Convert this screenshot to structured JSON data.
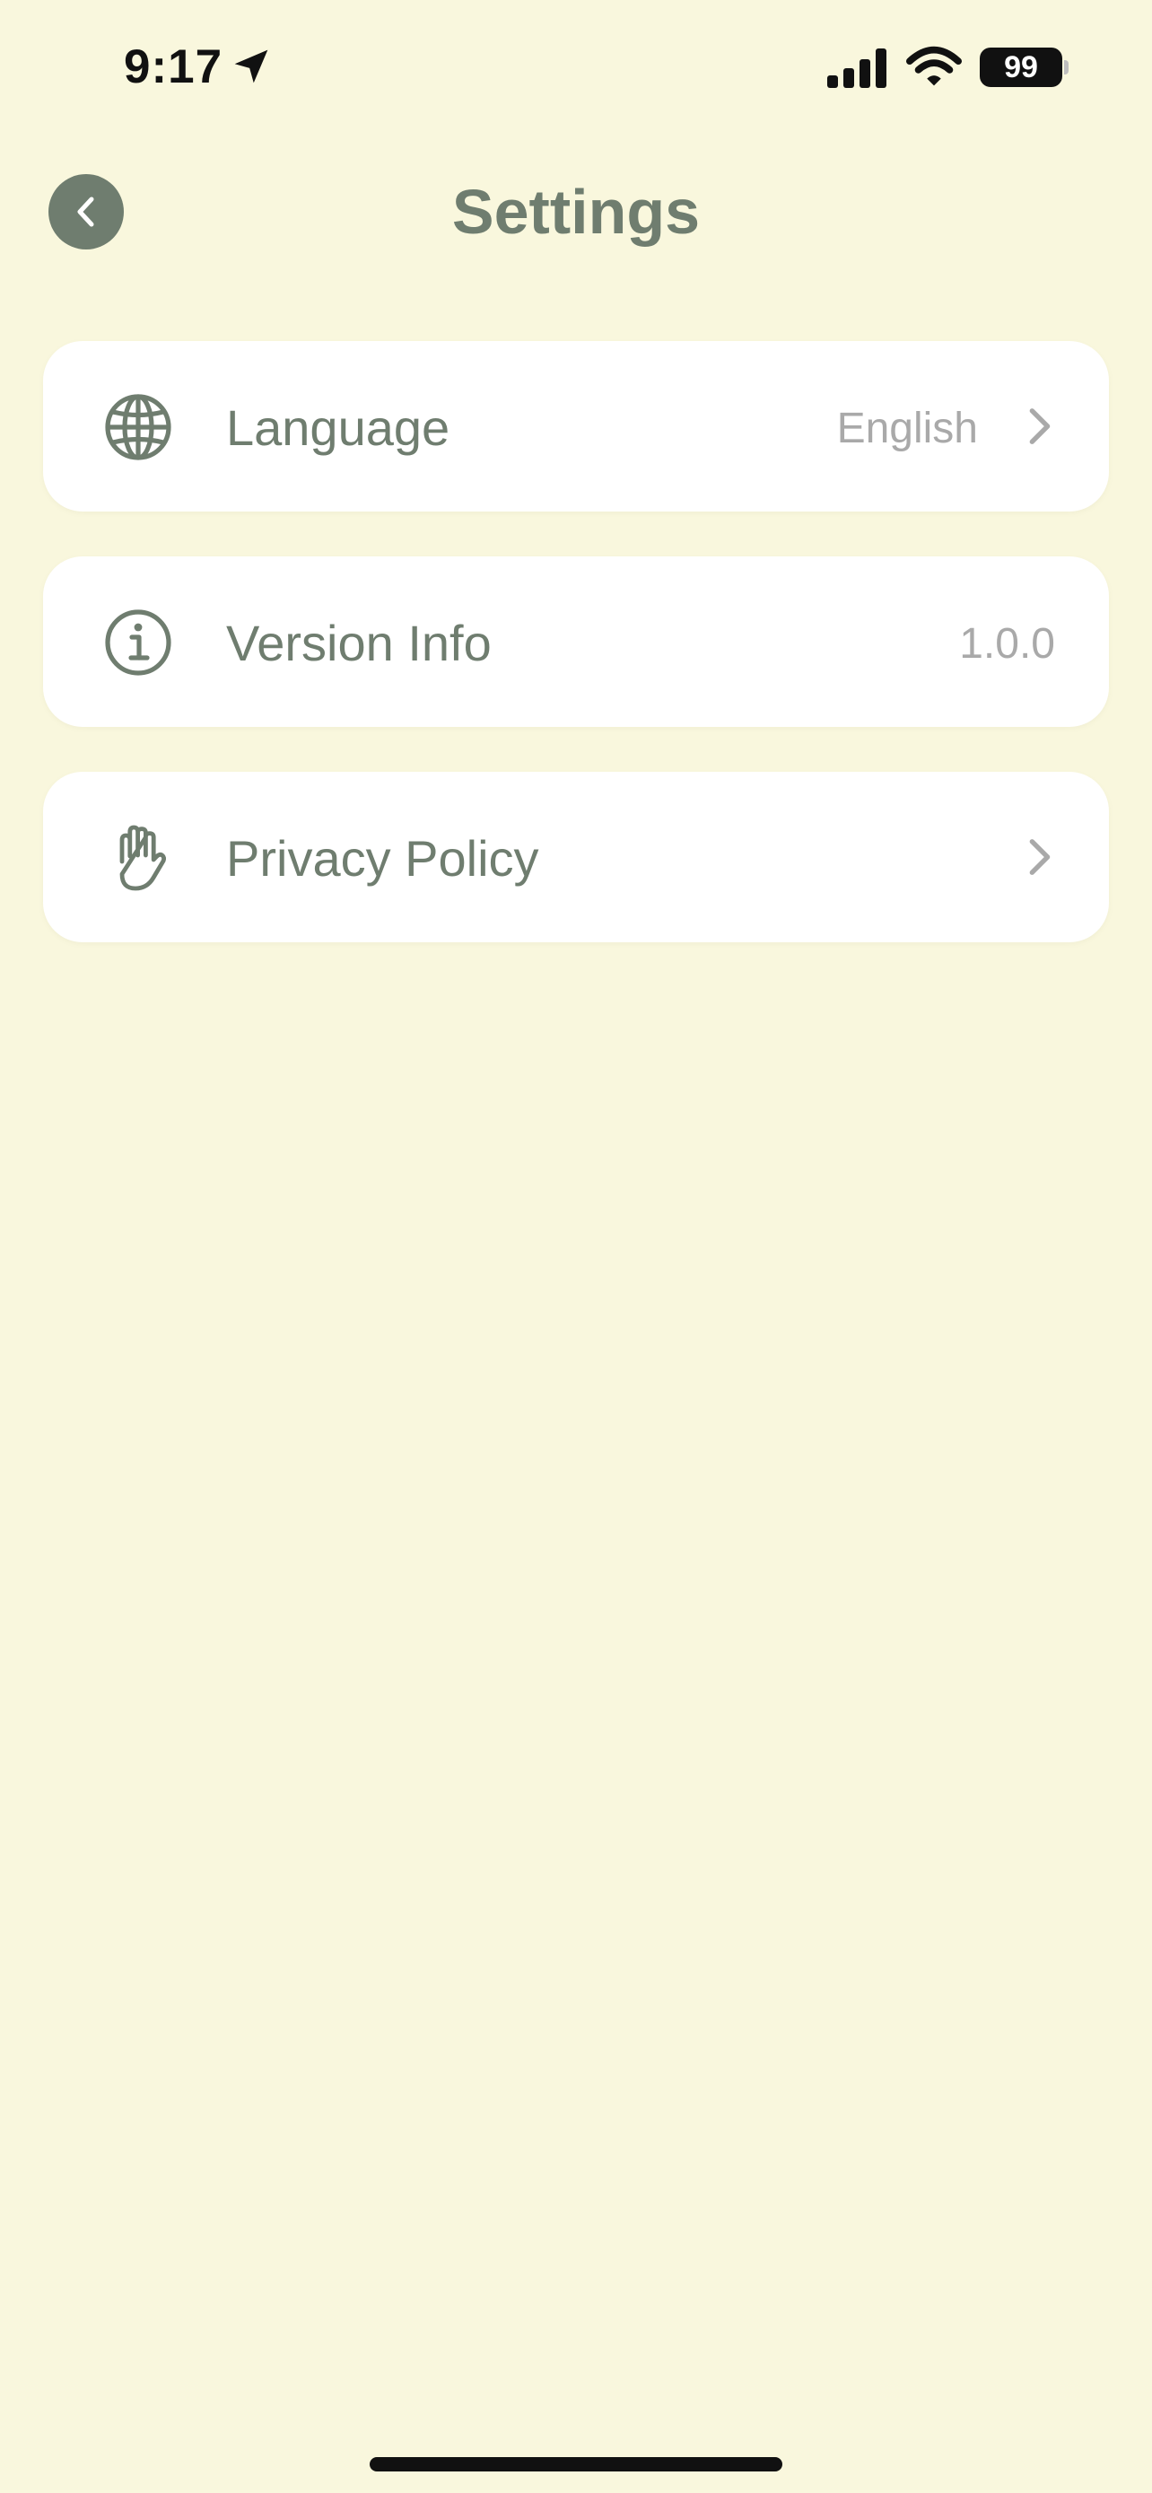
{
  "status_bar": {
    "time": "9:17",
    "battery": "99"
  },
  "header": {
    "title": "Settings",
    "back_icon": "chevron-left-icon"
  },
  "settings": [
    {
      "label": "Language",
      "value": "English",
      "icon": "globe-icon",
      "chevron": true
    },
    {
      "label": "Version Info",
      "value": "1.0.0",
      "icon": "info-circle-icon",
      "chevron": false
    },
    {
      "label": "Privacy Policy",
      "value": "",
      "icon": "hand-icon",
      "chevron": true
    }
  ],
  "colors": {
    "background": "#f9f7dd",
    "accent": "#6f7d6f",
    "card": "#ffffff",
    "muted": "#a9a9a9"
  }
}
